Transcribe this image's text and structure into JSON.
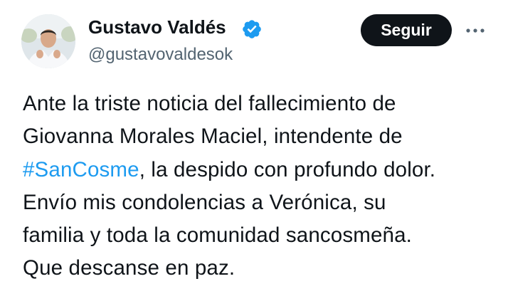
{
  "author": {
    "display_name": "Gustavo Valdés",
    "handle": "@gustavovaldesok",
    "verified": true,
    "verified_color": "#1d9bf0",
    "avatar_icon": "profile-photo"
  },
  "actions": {
    "follow_label": "Seguir",
    "more_icon": "more-horizontal-icon"
  },
  "tweet": {
    "line1": "Ante la triste noticia del fallecimiento de",
    "line2": "Giovanna Morales Maciel, intendente de",
    "line3_hashtag": "#SanCosme",
    "line3_rest": ", la despido con profundo dolor.",
    "line4": "Envío mis condolencias a Verónica, su",
    "line5": "familia y toda la comunidad sancosmeña.",
    "line6": "Que descanse en paz."
  },
  "colors": {
    "text": "#0f1419",
    "secondary_text": "#536471",
    "link": "#1d9bf0",
    "button_bg": "#0f1419",
    "button_text": "#ffffff"
  }
}
